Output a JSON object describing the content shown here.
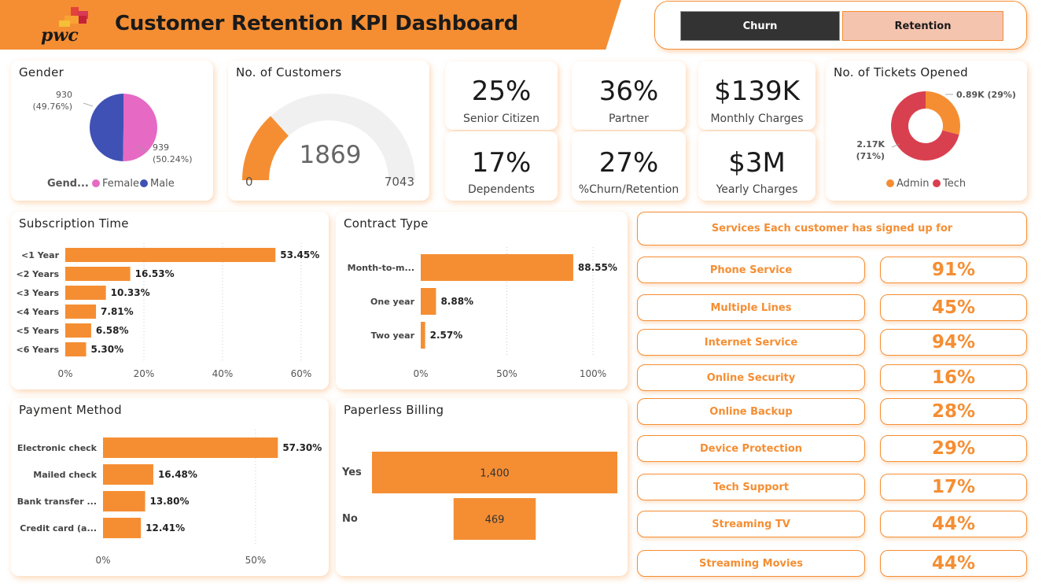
{
  "header": {
    "title": "Customer Retention KPI Dashboard",
    "logo_text": "pwc"
  },
  "toggle": {
    "churn_label": "Churn",
    "retention_label": "Retention"
  },
  "gender": {
    "title": "Gender",
    "female_value": "939",
    "female_pct": "(50.24%)",
    "male_value": "930",
    "male_pct": "(49.76%)",
    "legend_title": "Gend...",
    "female_label": "Female",
    "male_label": "Male",
    "female_color": "#e66ac4",
    "male_color": "#4051b5"
  },
  "customers": {
    "title": "No. of Customers",
    "value": "1869",
    "min": "0",
    "max": "7043"
  },
  "kpis": {
    "senior_value": "25%",
    "senior_label": "Senior Citizen",
    "partner_value": "36%",
    "partner_label": "Partner",
    "monthly_value": "$139K",
    "monthly_label": "Monthly Charges",
    "dependents_value": "17%",
    "dependents_label": "Dependents",
    "churn_value": "27%",
    "churn_label": "%Churn/Retention",
    "yearly_value": "$3M",
    "yearly_label": "Yearly Charges"
  },
  "tickets": {
    "title": "No. of Tickets Opened",
    "admin_value": "0.89K",
    "admin_pct": "(29%)",
    "tech_value": "2.17K",
    "tech_pct": "(71%)",
    "admin_label": "Admin",
    "tech_label": "Tech",
    "admin_color": "#f58e33",
    "tech_color": "#d9404f"
  },
  "subscription": {
    "title": "Subscription Time",
    "axis_ticks": [
      "0%",
      "20%",
      "40%",
      "60%"
    ]
  },
  "contract": {
    "title": "Contract Type",
    "axis_ticks": [
      "0%",
      "50%",
      "100%"
    ]
  },
  "payment": {
    "title": "Payment Method",
    "axis_ticks": [
      "0%",
      "50%"
    ]
  },
  "paperless": {
    "title": "Paperless Billing"
  },
  "services": {
    "header": "Services Each customer has signed up for",
    "items": [
      {
        "label": "Phone Service",
        "value": "91%"
      },
      {
        "label": "Multiple Lines",
        "value": "45%"
      },
      {
        "label": "Internet Service",
        "value": "94%"
      },
      {
        "label": "Online Security",
        "value": "16%"
      },
      {
        "label": "Online Backup",
        "value": "28%"
      },
      {
        "label": "Device Protection",
        "value": "29%"
      },
      {
        "label": "Tech Support",
        "value": "17%"
      },
      {
        "label": "Streaming TV",
        "value": "44%"
      },
      {
        "label": "Streaming Movies",
        "value": "44%"
      }
    ]
  },
  "colors": {
    "accent": "#f58e33",
    "dark": "#333333",
    "retention_bg": "#f5c4ae"
  },
  "chart_data": [
    {
      "type": "pie",
      "categories": [
        "Female",
        "Male"
      ],
      "values": [
        939,
        930
      ],
      "percent_labels": [
        "(50.24%)",
        "(49.76%)"
      ],
      "title": "Gender",
      "legend": "bottom"
    },
    {
      "type": "gauge",
      "value": 1869,
      "min": 0,
      "max": 7043,
      "title": "No. of Customers"
    },
    {
      "type": "pie",
      "subtype": "donut",
      "categories": [
        "Admin",
        "Tech"
      ],
      "values": [
        890,
        2170
      ],
      "value_labels": [
        "0.89K",
        "2.17K"
      ],
      "percent_labels": [
        "(29%)",
        "(71%)"
      ],
      "title": "No. of Tickets Opened",
      "legend": "bottom"
    },
    {
      "type": "bar",
      "orientation": "horizontal",
      "title": "Subscription Time",
      "categories": [
        "<1 Year",
        "<2 Years",
        "<3 Years",
        "<4 Years",
        "<5 Years",
        "<6 Years"
      ],
      "values": [
        53.45,
        16.53,
        10.33,
        7.81,
        6.58,
        5.3
      ],
      "value_labels": [
        "53.45%",
        "16.53%",
        "10.33%",
        "7.81%",
        "6.58%",
        "5.30%"
      ],
      "xlim": [
        0,
        60
      ],
      "grid": true
    },
    {
      "type": "bar",
      "orientation": "horizontal",
      "title": "Contract Type",
      "categories": [
        "Month-to-m...",
        "One year",
        "Two year"
      ],
      "values": [
        88.55,
        8.88,
        2.57
      ],
      "value_labels": [
        "88.55%",
        "8.88%",
        "2.57%"
      ],
      "xlim": [
        0,
        100
      ],
      "grid": true
    },
    {
      "type": "bar",
      "orientation": "horizontal",
      "title": "Payment Method",
      "categories": [
        "Electronic check",
        "Mailed check",
        "Bank transfer ...",
        "Credit card (a..."
      ],
      "values": [
        57.3,
        16.48,
        13.8,
        12.41
      ],
      "value_labels": [
        "57.30%",
        "16.48%",
        "13.80%",
        "12.41%"
      ],
      "xlim": [
        0,
        50
      ],
      "grid": true
    },
    {
      "type": "bar",
      "subtype": "funnel",
      "title": "Paperless Billing",
      "categories": [
        "Yes",
        "No"
      ],
      "values": [
        1400,
        469
      ],
      "value_labels": [
        "1,400",
        "469"
      ]
    }
  ]
}
